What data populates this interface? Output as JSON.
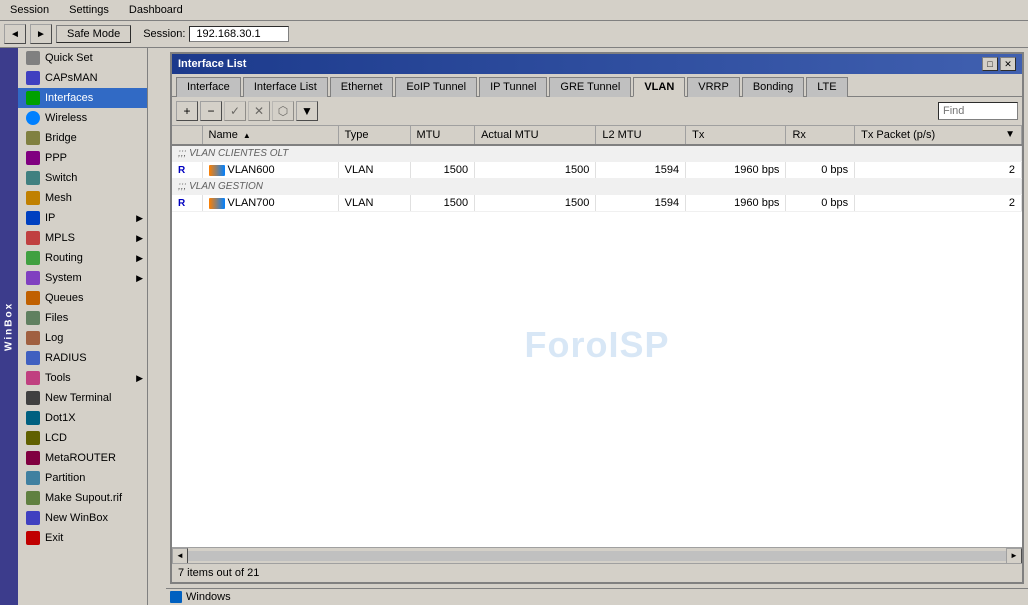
{
  "menubar": {
    "items": [
      "Session",
      "Settings",
      "Dashboard"
    ]
  },
  "toolbar": {
    "back_label": "◄",
    "forward_label": "►",
    "safe_mode_label": "Safe Mode",
    "session_label": "Session:",
    "session_value": "192.168.30.1"
  },
  "sidebar": {
    "items": [
      {
        "id": "quick-set",
        "label": "Quick Set",
        "icon": "quickset",
        "has_arrow": false
      },
      {
        "id": "capsman",
        "label": "CAPsMAN",
        "icon": "capsman",
        "has_arrow": false
      },
      {
        "id": "interfaces",
        "label": "Interfaces",
        "icon": "interfaces",
        "has_arrow": false,
        "active": true
      },
      {
        "id": "wireless",
        "label": "Wireless",
        "icon": "wireless",
        "has_arrow": false
      },
      {
        "id": "bridge",
        "label": "Bridge",
        "icon": "bridge",
        "has_arrow": false
      },
      {
        "id": "ppp",
        "label": "PPP",
        "icon": "ppp",
        "has_arrow": false
      },
      {
        "id": "switch",
        "label": "Switch",
        "icon": "switch",
        "has_arrow": false
      },
      {
        "id": "mesh",
        "label": "Mesh",
        "icon": "mesh",
        "has_arrow": false
      },
      {
        "id": "ip",
        "label": "IP",
        "icon": "ip",
        "has_arrow": true
      },
      {
        "id": "mpls",
        "label": "MPLS",
        "icon": "mpls",
        "has_arrow": true
      },
      {
        "id": "routing",
        "label": "Routing",
        "icon": "routing",
        "has_arrow": true
      },
      {
        "id": "system",
        "label": "System",
        "icon": "system",
        "has_arrow": true
      },
      {
        "id": "queues",
        "label": "Queues",
        "icon": "queues",
        "has_arrow": false
      },
      {
        "id": "files",
        "label": "Files",
        "icon": "files",
        "has_arrow": false
      },
      {
        "id": "log",
        "label": "Log",
        "icon": "log",
        "has_arrow": false
      },
      {
        "id": "radius",
        "label": "RADIUS",
        "icon": "radius",
        "has_arrow": false
      },
      {
        "id": "tools",
        "label": "Tools",
        "icon": "tools",
        "has_arrow": true
      },
      {
        "id": "new-terminal",
        "label": "New Terminal",
        "icon": "new-terminal",
        "has_arrow": false
      },
      {
        "id": "dot1x",
        "label": "Dot1X",
        "icon": "dot1x",
        "has_arrow": false
      },
      {
        "id": "lcd",
        "label": "LCD",
        "icon": "lcd",
        "has_arrow": false
      },
      {
        "id": "metarouter",
        "label": "MetaROUTER",
        "icon": "metarouter",
        "has_arrow": false
      },
      {
        "id": "partition",
        "label": "Partition",
        "icon": "partition",
        "has_arrow": false
      },
      {
        "id": "make-supout",
        "label": "Make Supout.rif",
        "icon": "make-supout",
        "has_arrow": false
      },
      {
        "id": "new-winbox",
        "label": "New WinBox",
        "icon": "new-winbox",
        "has_arrow": false
      },
      {
        "id": "exit",
        "label": "Exit",
        "icon": "exit",
        "has_arrow": false
      }
    ]
  },
  "windows_bar": {
    "label": "Windows"
  },
  "window": {
    "title": "Interface List",
    "tabs": [
      {
        "id": "interface",
        "label": "Interface"
      },
      {
        "id": "interface-list",
        "label": "Interface List"
      },
      {
        "id": "ethernet",
        "label": "Ethernet"
      },
      {
        "id": "eoip-tunnel",
        "label": "EoIP Tunnel"
      },
      {
        "id": "ip-tunnel",
        "label": "IP Tunnel"
      },
      {
        "id": "gre-tunnel",
        "label": "GRE Tunnel"
      },
      {
        "id": "vlan",
        "label": "VLAN",
        "active": true
      },
      {
        "id": "vrrp",
        "label": "VRRP"
      },
      {
        "id": "bonding",
        "label": "Bonding"
      },
      {
        "id": "lte",
        "label": "LTE"
      }
    ],
    "toolbar_buttons": [
      {
        "id": "add",
        "label": "+",
        "tooltip": "Add"
      },
      {
        "id": "remove",
        "label": "−",
        "tooltip": "Remove"
      },
      {
        "id": "enable",
        "label": "✓",
        "tooltip": "Enable"
      },
      {
        "id": "disable",
        "label": "✕",
        "tooltip": "Disable"
      },
      {
        "id": "copy",
        "label": "⬡",
        "tooltip": "Copy"
      },
      {
        "id": "filter",
        "label": "⚙",
        "tooltip": "Filter"
      }
    ],
    "search_placeholder": "Find",
    "columns": [
      {
        "id": "flag",
        "label": ""
      },
      {
        "id": "name",
        "label": "Name"
      },
      {
        "id": "type",
        "label": "Type"
      },
      {
        "id": "mtu",
        "label": "MTU"
      },
      {
        "id": "actual-mtu",
        "label": "Actual MTU"
      },
      {
        "id": "l2-mtu",
        "label": "L2 MTU"
      },
      {
        "id": "tx",
        "label": "Tx"
      },
      {
        "id": "rx",
        "label": "Rx"
      },
      {
        "id": "tx-packet",
        "label": "Tx Packet (p/s)"
      }
    ],
    "groups": [
      {
        "label": ";;; VLAN CLIENTES OLT",
        "rows": [
          {
            "flag": "R",
            "name": "VLAN600",
            "type": "VLAN",
            "mtu": "1500",
            "actual_mtu": "1500",
            "l2_mtu": "1594",
            "tx": "1960 bps",
            "rx": "0 bps",
            "tx_packet": "2"
          }
        ]
      },
      {
        "label": ";;; VLAN GESTION",
        "rows": [
          {
            "flag": "R",
            "name": "VLAN700",
            "type": "VLAN",
            "mtu": "1500",
            "actual_mtu": "1500",
            "l2_mtu": "1594",
            "tx": "1960 bps",
            "rx": "0 bps",
            "tx_packet": "2"
          }
        ]
      }
    ],
    "statusbar": "7 items out of 21",
    "watermark": "ForoISP"
  },
  "winbox": {
    "label": "WinBox"
  }
}
